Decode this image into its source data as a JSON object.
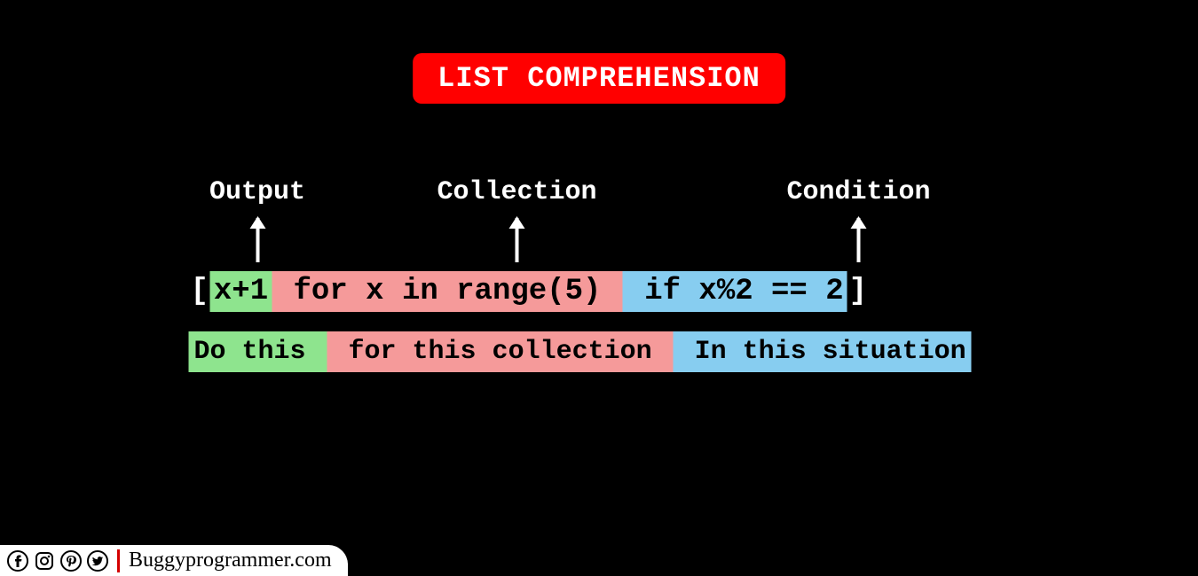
{
  "title": "LIST COMPREHENSION",
  "labels": {
    "output": "Output",
    "collection": "Collection",
    "condition": "Condition"
  },
  "code": {
    "open_bracket": "[",
    "output_expr": "x+1",
    "collection_expr": " for x in range(5) ",
    "condition_expr": " if x%2 == 2",
    "close_bracket": "]"
  },
  "explain": {
    "output": "Do this ",
    "collection": " for this collection ",
    "condition": " In this situation"
  },
  "colors": {
    "output": "#8ee48e",
    "collection": "#f59a9a",
    "condition": "#87cdf0",
    "title_bg": "#ff0000"
  },
  "footer": {
    "brand": "Buggyprogrammer.com",
    "social": [
      "facebook-icon",
      "instagram-icon",
      "pinterest-icon",
      "twitter-icon"
    ]
  }
}
